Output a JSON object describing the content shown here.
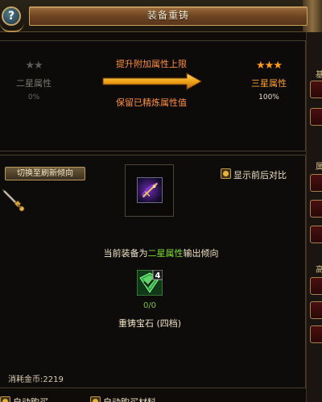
{
  "window": {
    "title": "装备重铸",
    "help_glyph": "?"
  },
  "upgrade": {
    "from_stars": "★★",
    "from_label": "二星属性",
    "from_percent": "0%",
    "to_stars": "★★★",
    "to_label": "三星属性",
    "to_percent": "100%",
    "line1": "提升附加属性上限",
    "line2": "保留已精炼属性值"
  },
  "controls": {
    "switch_label": "切换至刷新倾向",
    "compare_label": "显示前后对比"
  },
  "equipment": {
    "tendency_prefix": "当前装备为",
    "tendency_highlight": "二星属性",
    "tendency_suffix": "输出倾向"
  },
  "gem": {
    "tier_badge": "4",
    "count": "0/0",
    "name": "重铸宝石 (四档)"
  },
  "cost": {
    "text": "消耗金币:2219"
  },
  "bottom": {
    "option1": "自动购买…",
    "option2": "自动购买材料"
  },
  "side": {
    "char1": "基",
    "char2": "属",
    "char3": "高"
  },
  "colors": {
    "accent_orange": "#ff8e3a",
    "star_gold": "#ff9a1a",
    "highlight_green": "#7de02b"
  }
}
